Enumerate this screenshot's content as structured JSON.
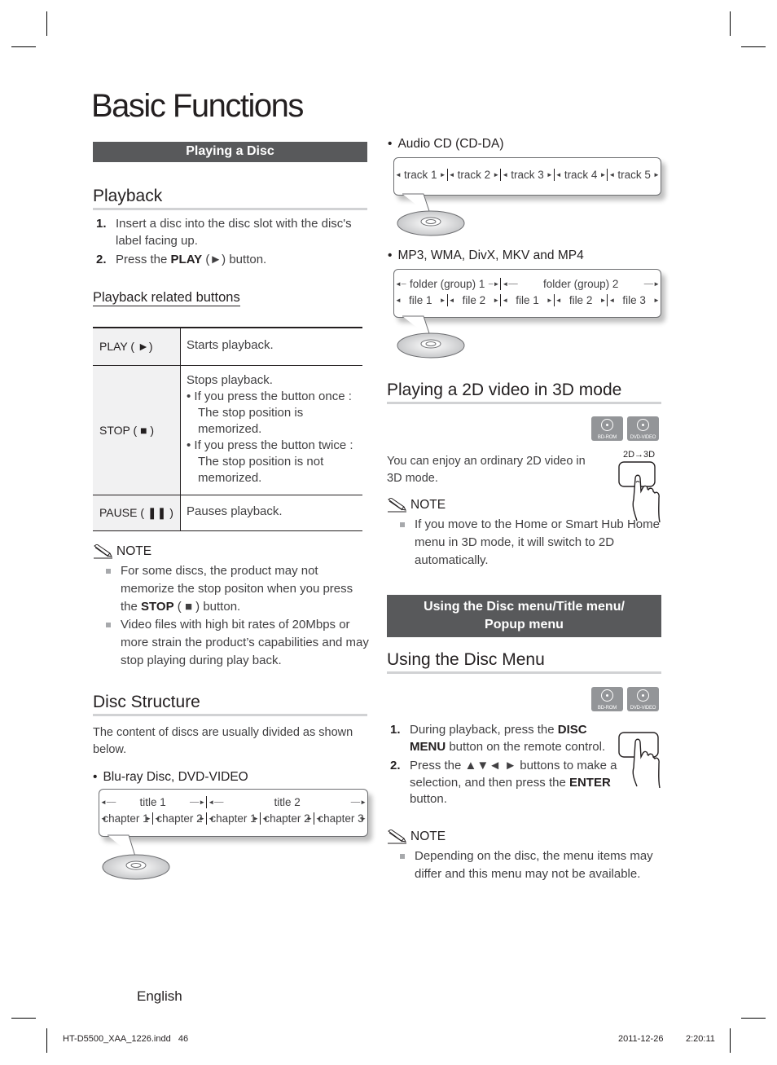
{
  "page_title": "Basic Functions",
  "left": {
    "section_bar": "Playing a Disc",
    "playback": {
      "heading": "Playback",
      "steps": [
        {
          "num": "1.",
          "text": "Insert a disc into the disc slot with the disc's label facing up."
        },
        {
          "num": "2.",
          "pre": "Press the ",
          "bold": "PLAY",
          "post": " (►) button."
        }
      ]
    },
    "related": {
      "heading": "Playback related buttons",
      "rows": [
        {
          "key": "PLAY",
          "symbol": "( ►)",
          "desc_lines": [
            "Starts playback."
          ]
        },
        {
          "key": "STOP",
          "symbol": "( ■ )",
          "desc_lines": [
            "Stops playback."
          ],
          "bullets": [
            "If you press the button once : The stop position is memorized.",
            "If you press the button twice : The stop position is not memorized."
          ]
        },
        {
          "key": "PAUSE",
          "symbol": "( ❚❚ )",
          "desc_lines": [
            "Pauses playback."
          ]
        }
      ]
    },
    "note": {
      "label": "NOTE",
      "items": [
        {
          "pre": "For some discs, the product may not memorize the stop positon when you press the ",
          "bold": "STOP",
          "post": " ( ■ ) button."
        },
        {
          "pre": "Video files with high bit rates of 20Mbps or more strain the product’s capabilities and may stop playing during play back.",
          "bold": "",
          "post": ""
        }
      ]
    },
    "disc_structure": {
      "heading": "Disc Structure",
      "intro": "The content of discs are usually divided as shown below.",
      "bluray": {
        "label": "Blu-ray Disc, DVD-VIDEO",
        "groups": [
          {
            "label": "title 1",
            "span": 2
          },
          {
            "label": "title 2",
            "span": 3
          }
        ],
        "items": [
          "chapter 1",
          "chapter 2",
          "chapter 1",
          "chapter 2",
          "chapter 3"
        ]
      }
    }
  },
  "right": {
    "audio_cd": {
      "label": "Audio CD (CD-DA)",
      "items": [
        "track 1",
        "track 2",
        "track 3",
        "track 4",
        "track 5"
      ]
    },
    "mp3": {
      "label": "MP3, WMA, DivX, MKV and MP4",
      "groups": [
        {
          "label": "folder (group) 1",
          "span": 2
        },
        {
          "label": "folder (group) 2",
          "span": 3
        }
      ],
      "items": [
        "file 1",
        "file 2",
        "file 1",
        "file 2",
        "file 3"
      ]
    },
    "mode_3d": {
      "heading": "Playing a 2D video in 3D mode",
      "badges": [
        "BD-ROM",
        "DVD-VIDEO"
      ],
      "text": "You can enjoy an ordinary 2D video in 3D mode.",
      "button_label": "2D→3D",
      "note_label": "NOTE",
      "note_items": [
        "If you move to the Home or Smart Hub Home menu in 3D mode, it will switch to 2D automatically."
      ]
    },
    "section_bar": [
      "Using the Disc menu/Title menu/",
      "Popup menu"
    ],
    "disc_menu": {
      "heading": "Using the Disc Menu",
      "badges": [
        "BD-ROM",
        "DVD-VIDEO"
      ],
      "steps": [
        {
          "num": "1.",
          "pre": "During playback, press the ",
          "bold": "DISC MENU",
          "post": "  button on the remote control."
        },
        {
          "num": "2.",
          "pre": "Press the ▲▼◄ ► buttons to make a selection, and then press the ",
          "bold": "ENTER",
          "post": " button."
        }
      ],
      "note_label": "NOTE",
      "note_items": [
        "Depending on the disc, the menu items may differ and this menu may not be available."
      ]
    }
  },
  "footer": {
    "language": "English",
    "slug_left": "HT-D5500_XAA_1226.indd   46",
    "slug_date": "2011-12-26",
    "slug_time": "2:20:11"
  }
}
